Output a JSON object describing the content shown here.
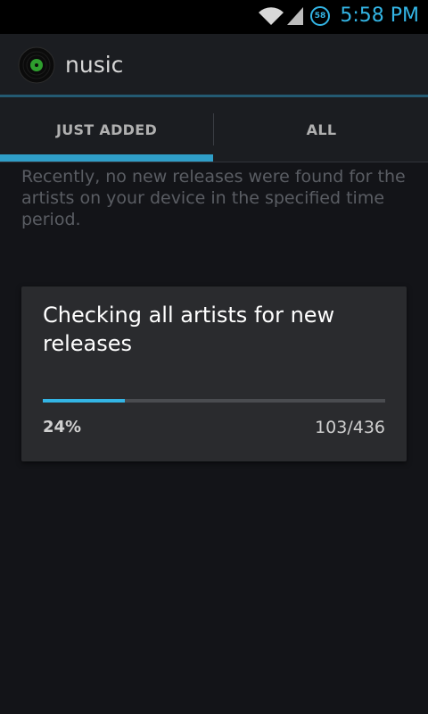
{
  "status_bar": {
    "time": "5:58 PM",
    "battery_level": "58",
    "icons": [
      "wifi-icon",
      "signal-icon",
      "battery-icon"
    ],
    "accent_color": "#33b5e5"
  },
  "action_bar": {
    "app_icon": "vinyl-record-icon",
    "title": "nusic"
  },
  "tabs": [
    {
      "label": "JUST ADDED",
      "selected": true
    },
    {
      "label": "ALL",
      "selected": false
    }
  ],
  "content": {
    "empty_message": "Recently, no new releases were found for the artists on your device in the specified time period."
  },
  "dialog": {
    "message": "Checking all artists for new releases",
    "progress_percent_label": "24%",
    "progress_fraction": 0.24,
    "progress_count": "103/436"
  },
  "colors": {
    "background": "#131418",
    "accent": "#33b5e5",
    "dialog_bg": "#2a2b2e"
  }
}
